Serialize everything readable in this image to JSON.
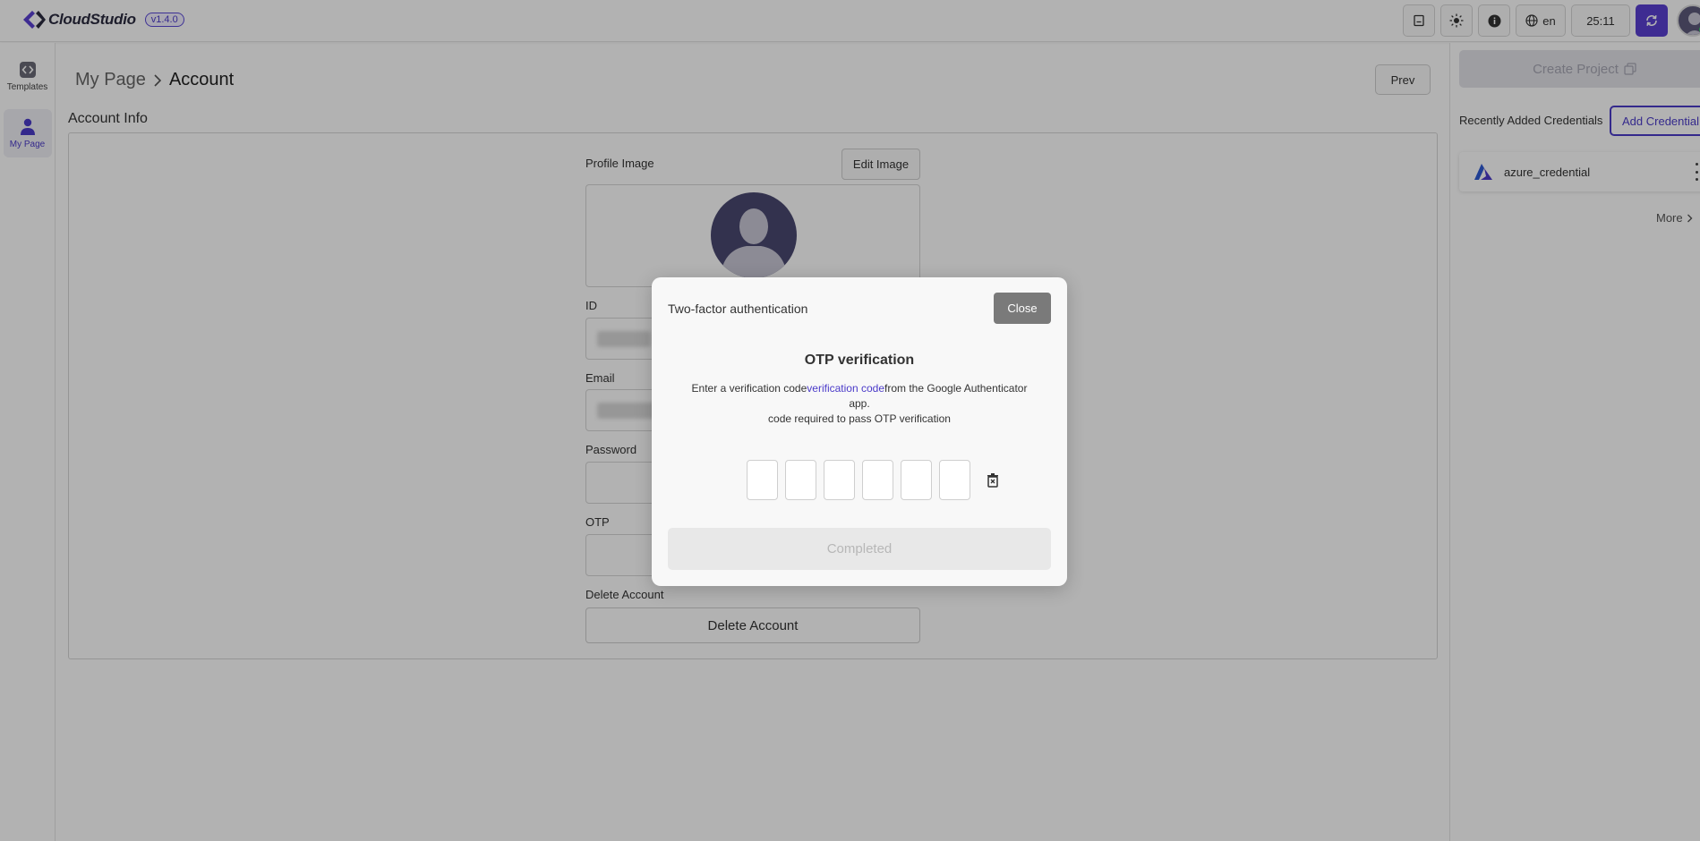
{
  "app": {
    "name": "CloudStudio",
    "version": "v1.4.0",
    "brand_color": "#5a3fd1"
  },
  "topbar": {
    "language": "en",
    "timer": "25:11"
  },
  "sidebar": {
    "items": [
      {
        "label": "Templates"
      },
      {
        "label": "My Page"
      }
    ]
  },
  "breadcrumb": {
    "root": "My Page",
    "current": "Account"
  },
  "page": {
    "prev_label": "Prev",
    "section_title": "Account Info",
    "profile_image_label": "Profile Image",
    "edit_image_label": "Edit Image",
    "id_label": "ID",
    "email_label": "Email",
    "password_label": "Password",
    "otp_label": "OTP",
    "delete_account_label": "Delete Account",
    "delete_account_button": "Delete Account"
  },
  "right_panel": {
    "create_project_label": "Create Project",
    "recent_label": "Recently Added Credentials",
    "add_credential_label": "Add Credential",
    "credential_name": "azure_credential",
    "more_label": "More"
  },
  "modal": {
    "title": "Two-factor authentication",
    "close_label": "Close",
    "heading": "OTP verification",
    "desc_part1": "Enter a verification code",
    "desc_highlight": "verification code",
    "desc_part2": "from the Google Authenticator app.",
    "desc_line2": "code required to pass OTP verification",
    "digits": [
      "",
      "",
      "",
      "",
      "",
      ""
    ],
    "completed_label": "Completed"
  }
}
